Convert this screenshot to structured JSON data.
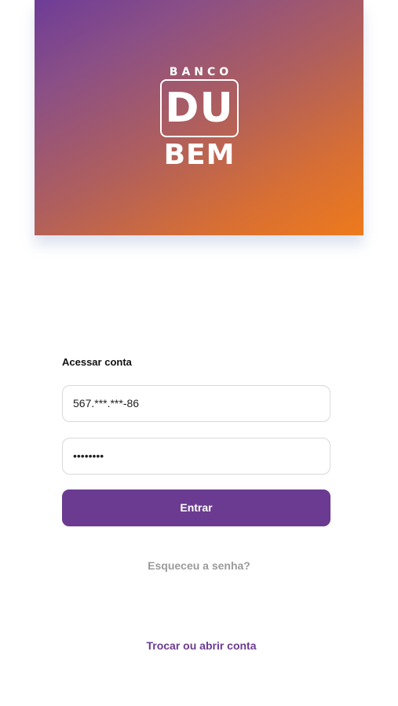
{
  "brand": {
    "banco": "BANCO",
    "du": "DU",
    "bem": "BEM"
  },
  "login": {
    "title": "Acessar conta",
    "cpf_value": "567.***.***-86",
    "password_value": "••••••••",
    "submit_label": "Entrar",
    "forgot_label": "Esqueceu a senha?",
    "switch_label": "Trocar ou abrir conta"
  },
  "colors": {
    "primary": "#6b3b91",
    "gradient_start": "#6e3c97",
    "gradient_end": "#ee7a1c",
    "muted_link": "#9b9b9b"
  }
}
